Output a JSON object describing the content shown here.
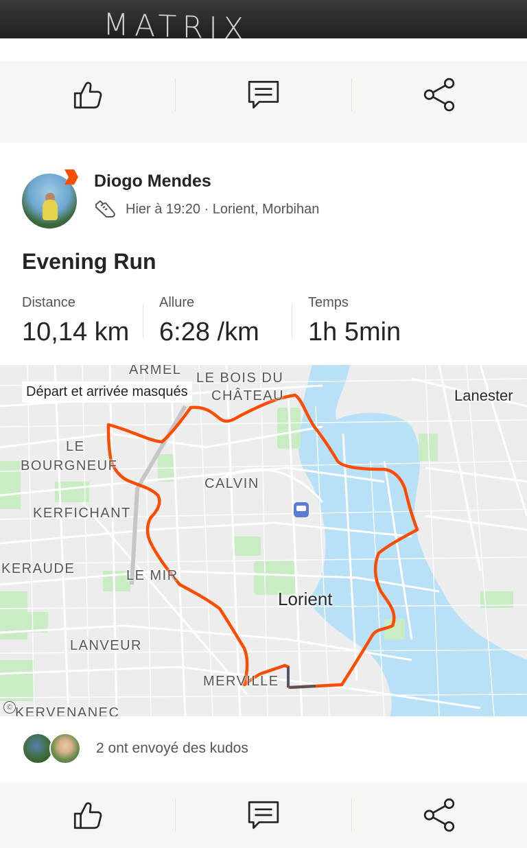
{
  "photo": {
    "brand_text": "MATRIX"
  },
  "actions": {
    "kudos_icon": "thumbs-up-icon",
    "comment_icon": "comment-icon",
    "share_icon": "share-icon"
  },
  "activity": {
    "athlete_name": "Diogo Mendes",
    "sport_icon": "running-shoe-icon",
    "datetime_location": "Hier à 19:20 · Lorient, Morbihan",
    "title": "Evening Run",
    "stats": [
      {
        "label": "Distance",
        "value": "10,14 km"
      },
      {
        "label": "Allure",
        "value": "6:28 /km"
      },
      {
        "label": "Temps",
        "value": "1h 5min"
      }
    ]
  },
  "map": {
    "privacy_notice": "Départ et arrivée masqués",
    "route_color": "#fc4c02",
    "water_color": "#b8e0f7",
    "park_color": "#c9ecc4",
    "city_label": "Lorient",
    "labels": {
      "armel": "ARMEL",
      "bois_du": "LE BOIS DU",
      "chateau": "CHÂTEAU",
      "lanester": "Lanester",
      "le": "LE",
      "bourgneuf": "BOURGNEUF",
      "calvin": "CALVIN",
      "kerfichant": "KERFICHANT",
      "keraude": "KERAUDE",
      "le_mir": "LE MIR",
      "lanveur": "LANVEUR",
      "merville": "MERVILLE",
      "kervenanec": "KERVENANEC"
    },
    "copyright_symbol": "©"
  },
  "kudos": {
    "text": "2 ont envoyé des kudos"
  }
}
